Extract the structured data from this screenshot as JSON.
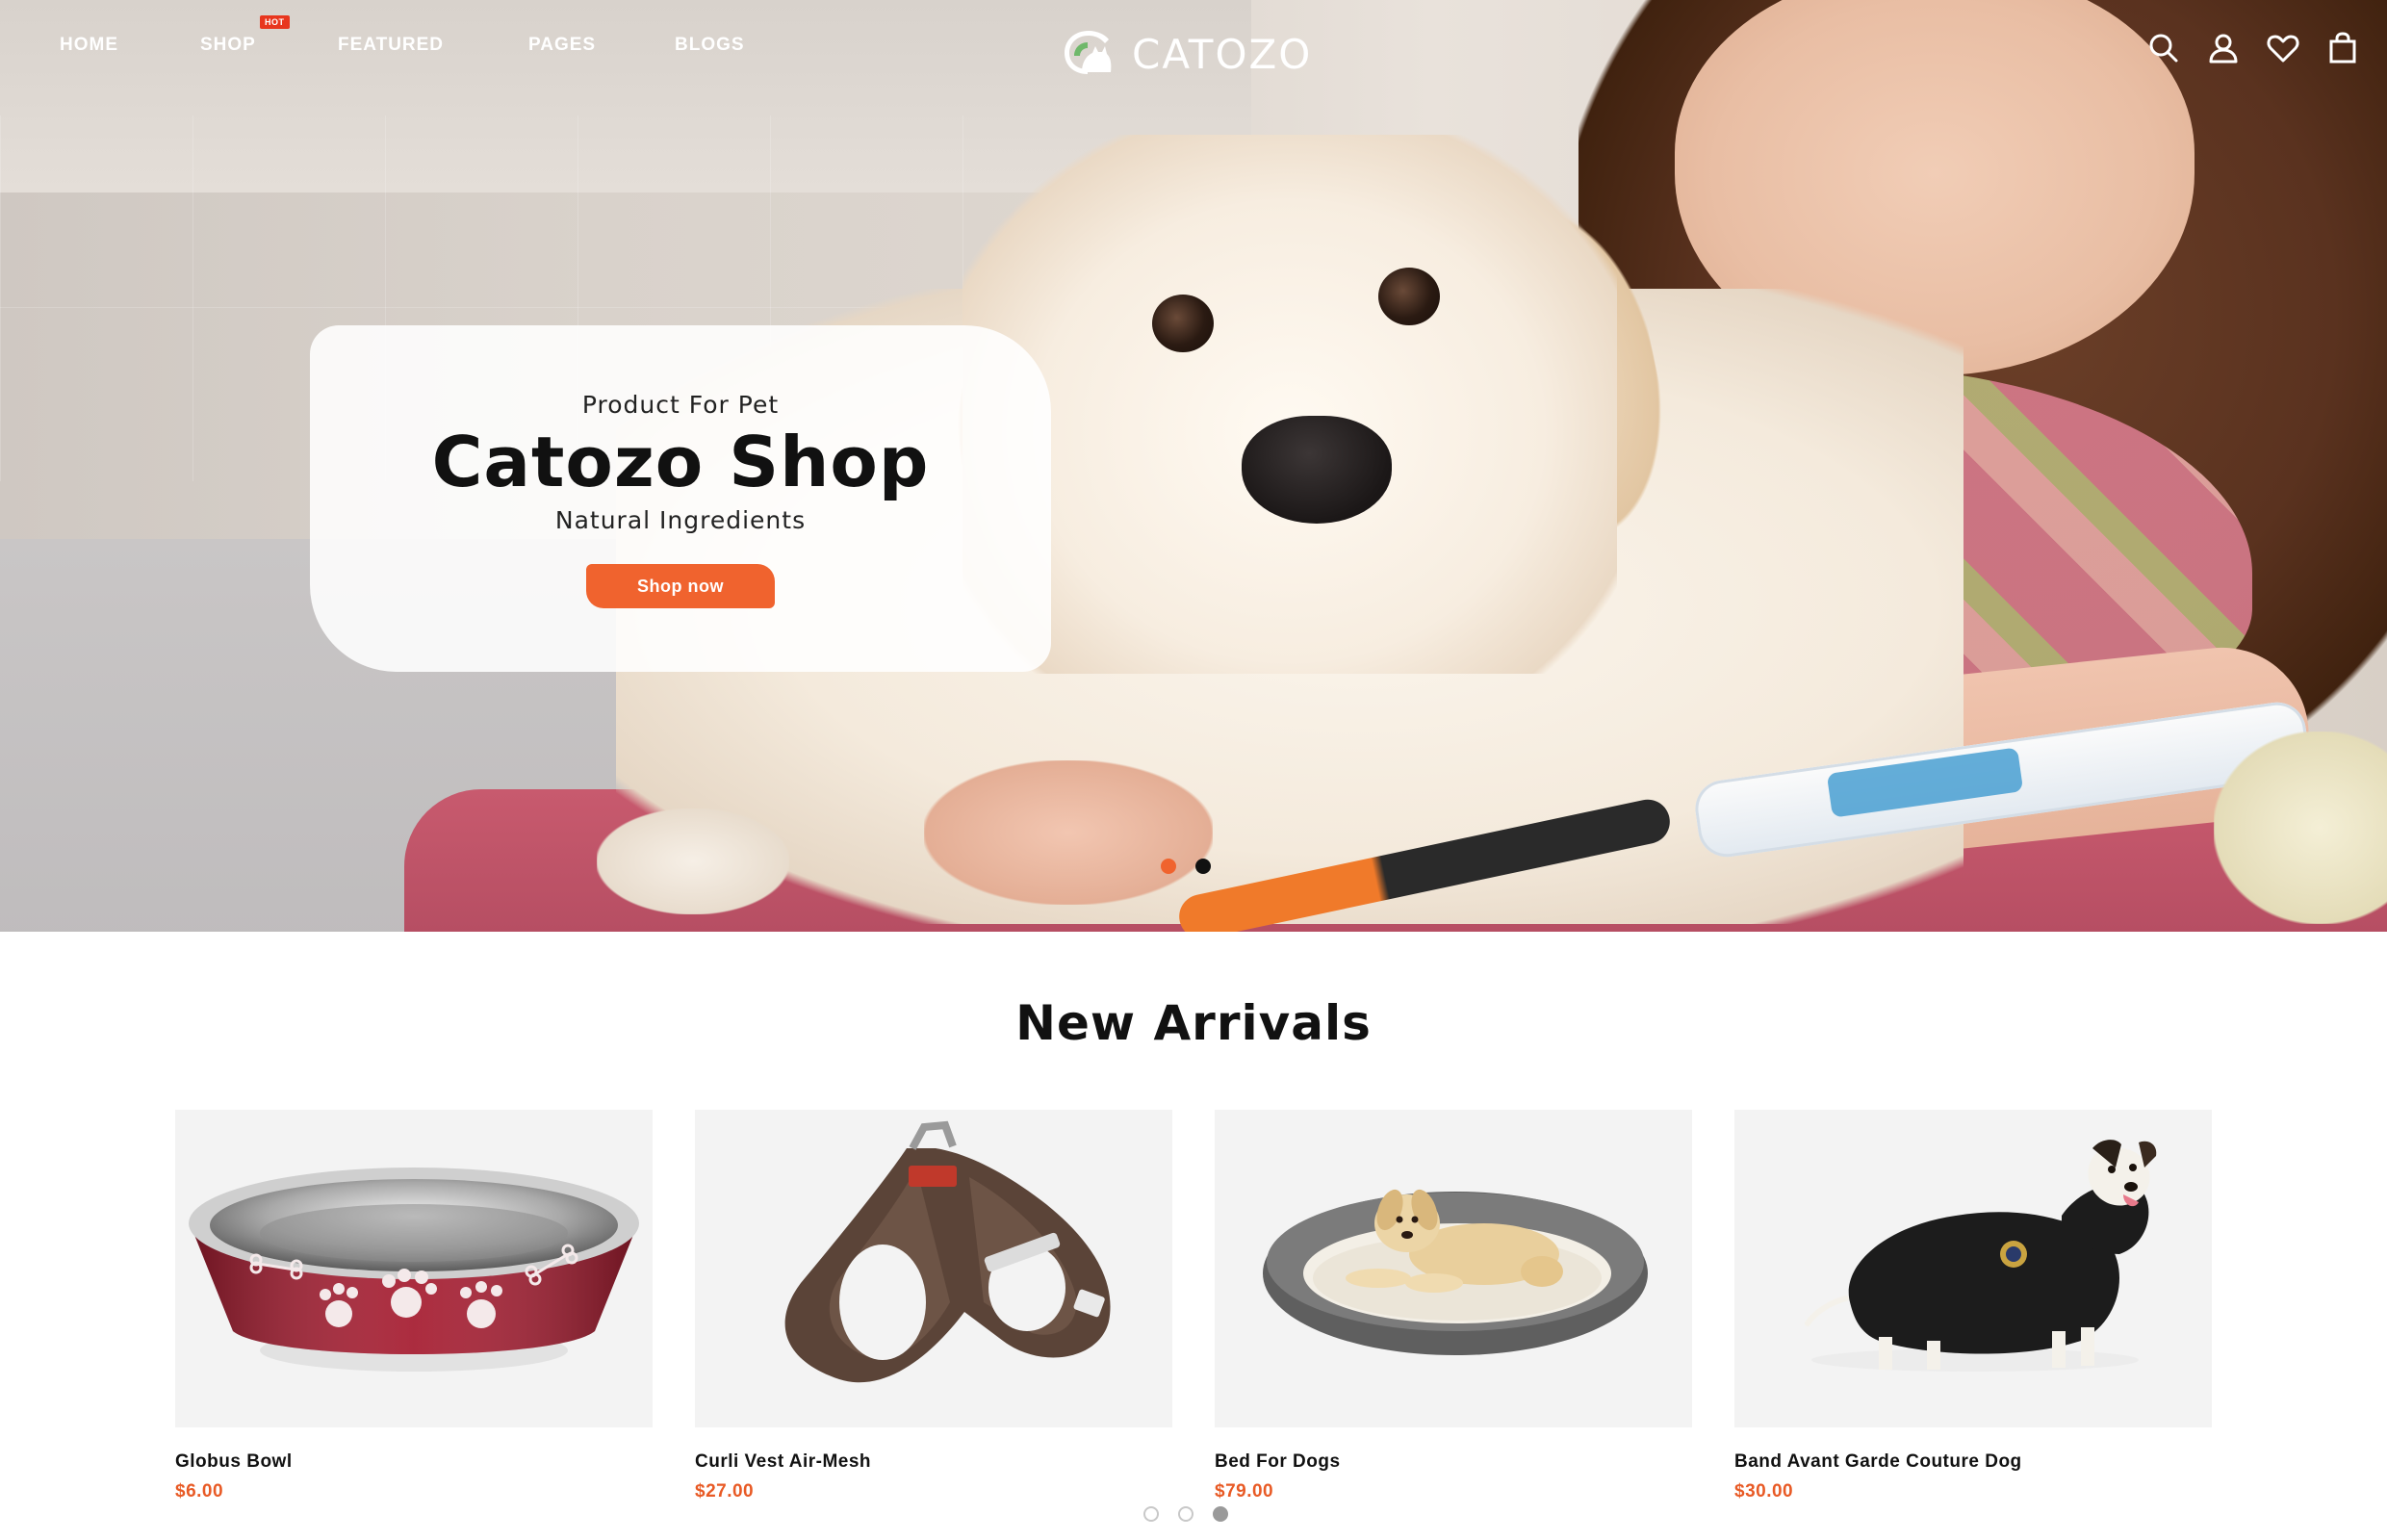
{
  "nav": {
    "items": [
      {
        "label": "HOME"
      },
      {
        "label": "SHOP",
        "badge": "HOT"
      },
      {
        "label": "FEATURED"
      },
      {
        "label": "PAGES"
      },
      {
        "label": "BLOGS"
      }
    ]
  },
  "brand": {
    "name": "CATOZO",
    "accent_color": "#f0632e",
    "badge_color": "#e8361e",
    "price_color": "#e85a25"
  },
  "header_icons": [
    "search-icon",
    "user-icon",
    "heart-icon",
    "shopping-bag-icon"
  ],
  "hero": {
    "eyebrow": "Product For Pet",
    "title": "Catozo Shop",
    "subtitle": "Natural Ingredients",
    "button_label": "Shop now",
    "slide_count": 2,
    "active_slide": 1
  },
  "new_arrivals": {
    "title": "New Arrivals",
    "products": [
      {
        "name": "Globus Bowl",
        "price": "$6.00"
      },
      {
        "name": "Curli Vest Air-Mesh",
        "price": "$27.00"
      },
      {
        "name": "Bed For Dogs",
        "price": "$79.00"
      },
      {
        "name": "Band Avant Garde Couture Dog",
        "price": "$30.00"
      }
    ],
    "page_count": 3,
    "active_page": 3
  }
}
